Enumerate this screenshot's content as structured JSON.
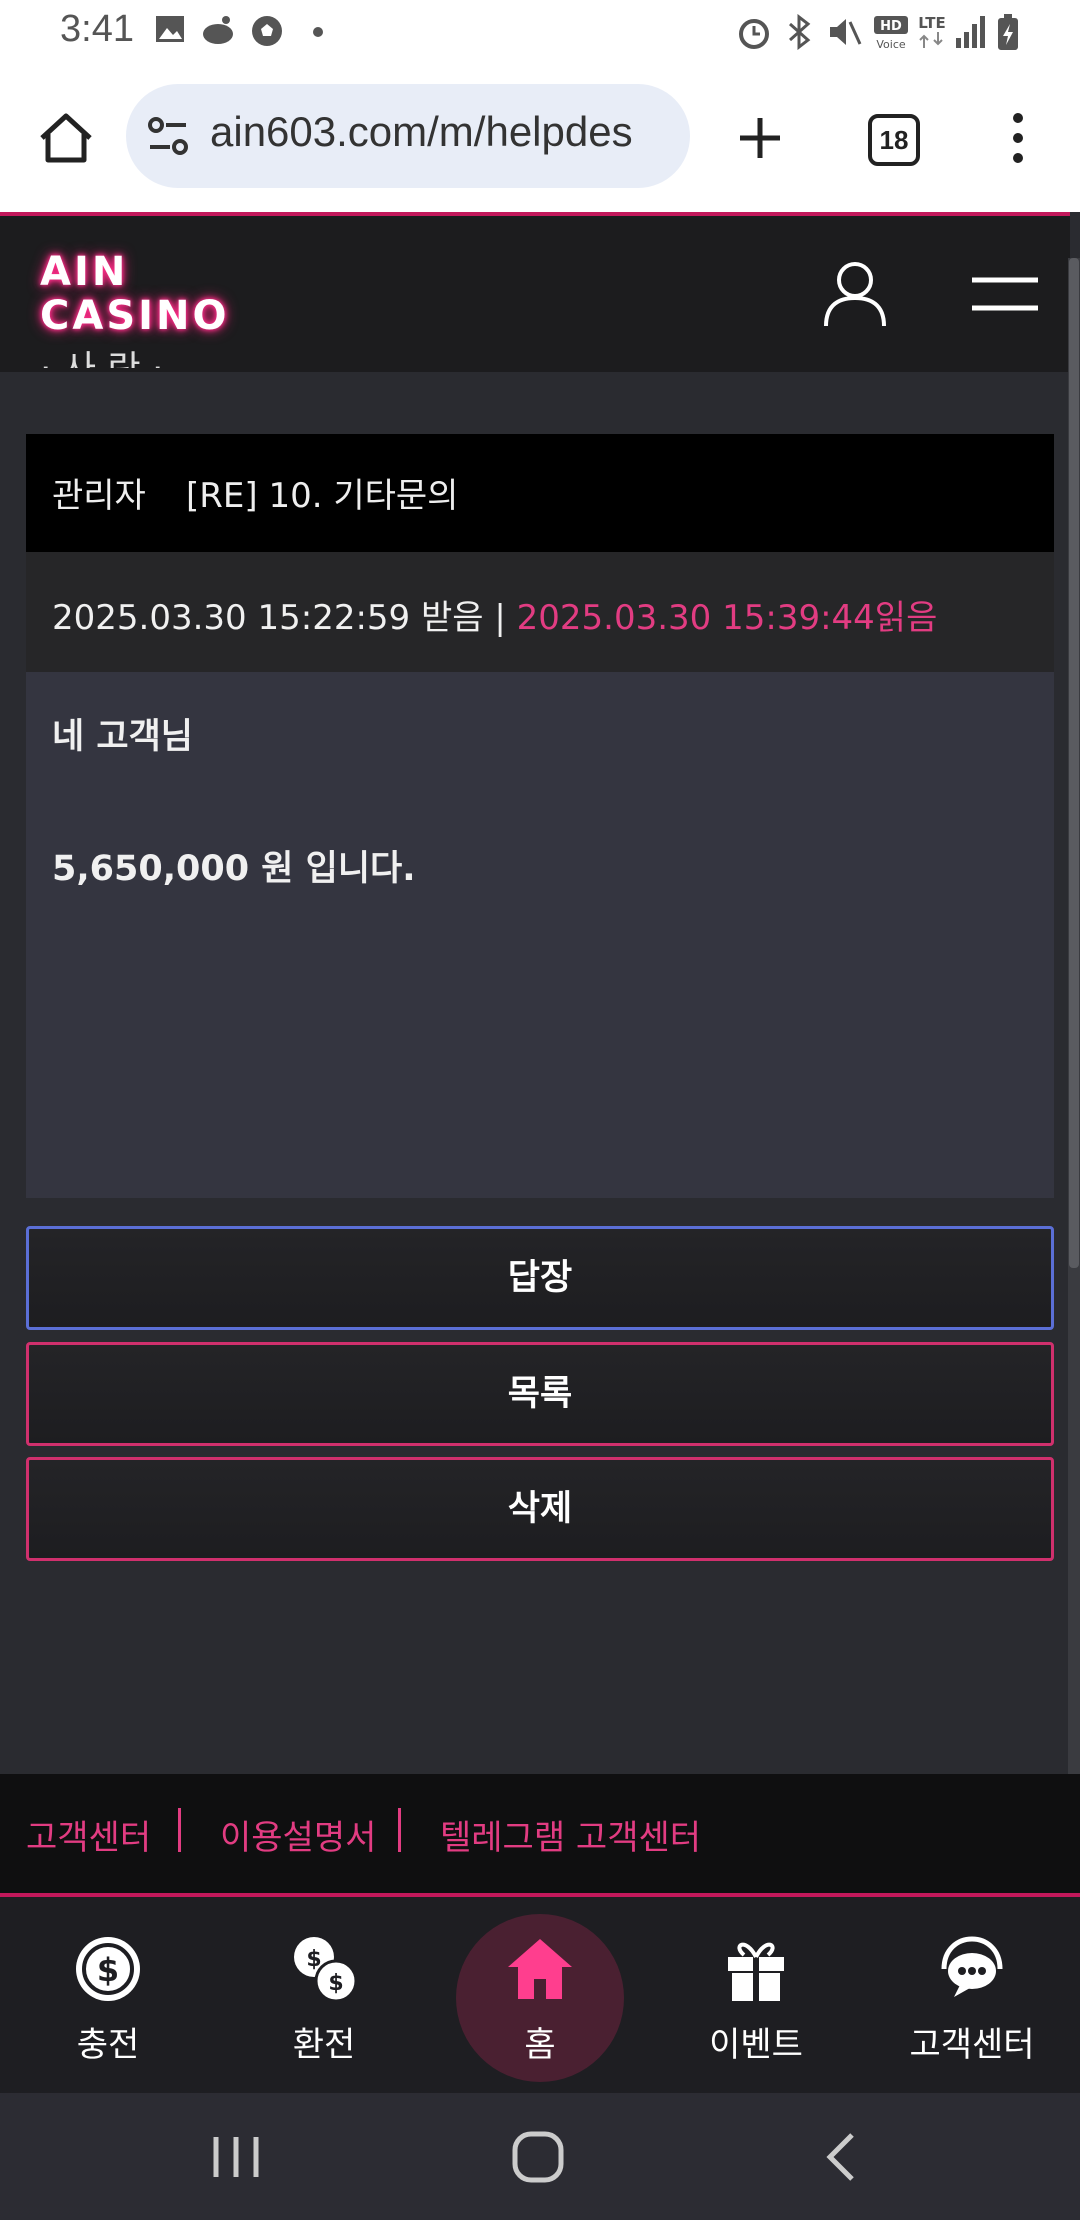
{
  "status_bar": {
    "time": "3:41"
  },
  "browser": {
    "url": "ain603.com/m/helpdes",
    "tab_count": "18"
  },
  "site": {
    "logo_line1": "AIN",
    "logo_line2": "CASINO"
  },
  "message": {
    "partial_above": "· 사 란 ·",
    "author": "관리자",
    "title": "[RE] 10. 기타문의",
    "received": "2025.03.30 15:22:59 받음 | ",
    "read": "2025.03.30 15:39:44읽음",
    "body_line1": "네 고객님",
    "body_line2": "5,650,000 원 입니다."
  },
  "buttons": {
    "reply": "답장",
    "list": "목록",
    "delete": "삭제"
  },
  "footer_links": [
    "고객센터",
    "이용설명서",
    "텔레그램 고객센터"
  ],
  "bottom_nav": [
    {
      "label": "충전",
      "icon": "dollar-coin-icon"
    },
    {
      "label": "환전",
      "icon": "exchange-coins-icon"
    },
    {
      "label": "홈",
      "icon": "home-icon"
    },
    {
      "label": "이벤트",
      "icon": "gift-icon"
    },
    {
      "label": "고객센터",
      "icon": "support-chat-icon"
    }
  ],
  "colors": {
    "accent": "#e23c82",
    "reply_border": "#5b6fd6",
    "header_bg": "#1c1c1e"
  }
}
